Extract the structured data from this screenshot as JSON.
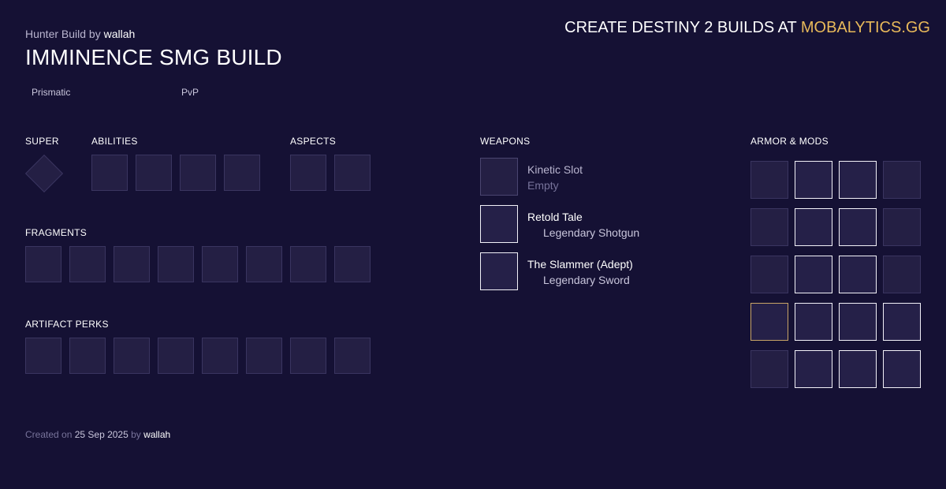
{
  "header": {
    "byline_prefix": "Hunter Build by",
    "author": "wallah",
    "title": "IMMINENCE SMG BUILD",
    "promo_prefix": "CREATE DESTINY 2 BUILDS AT",
    "promo_brand": "MOBALYTICS.GG"
  },
  "tags": [
    "Prismatic",
    "PvP"
  ],
  "sections": {
    "super": "SUPER",
    "abilities": "ABILITIES",
    "aspects": "ASPECTS",
    "fragments": "FRAGMENTS",
    "artifact_perks": "ARTIFACT PERKS",
    "weapons": "WEAPONS",
    "armor_mods": "ARMOR & MODS"
  },
  "weapons": [
    {
      "name": "Kinetic Slot",
      "type": "Empty"
    },
    {
      "name": "Retold Tale",
      "type": "Legendary Shotgun"
    },
    {
      "name": "The Slammer (Adept)",
      "type": "Legendary Sword"
    }
  ],
  "footer": {
    "prefix": "Created on",
    "date": "25 Sep 2025",
    "by": "by",
    "author": "wallah"
  },
  "colors": {
    "background": "#151134",
    "accent_gold": "#e8b95a",
    "slot_fill": "#241f44"
  }
}
